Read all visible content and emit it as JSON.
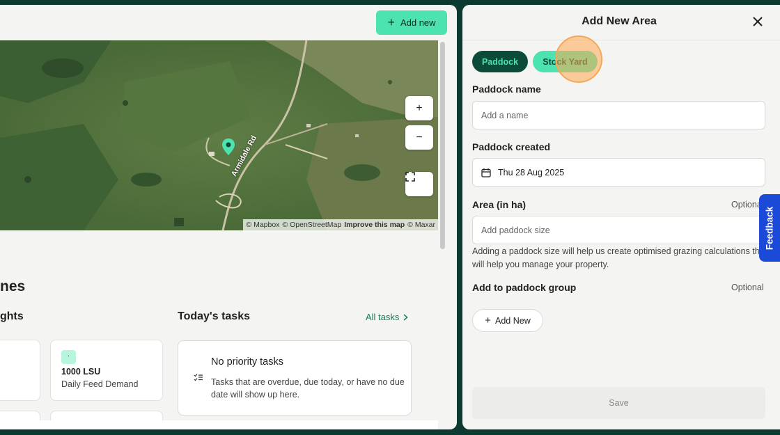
{
  "toolbar": {
    "add_new_label": "Add new"
  },
  "map": {
    "road_label": "Armidale Rd",
    "zoom_in": "+",
    "zoom_out": "−",
    "attribution": {
      "mapbox": "© Mapbox",
      "osm": "© OpenStreetMap",
      "improve": "Improve this map",
      "maxar": "© Maxar"
    }
  },
  "dashboard": {
    "heading_partial": "nes",
    "insights_partial": "ghts",
    "card": {
      "chip": "·",
      "value": "1000  LSU",
      "label": "Daily Feed Demand"
    },
    "tasks": {
      "title": "Today's tasks",
      "all_link": "All tasks",
      "empty_title": "No priority tasks",
      "empty_text": "Tasks that are overdue, due today, or have no due date will show up here."
    }
  },
  "drawer": {
    "title": "Add New Area",
    "tabs": [
      {
        "label": "Paddock",
        "active": true
      },
      {
        "label": "Stock Yard",
        "active": false
      }
    ],
    "fields": {
      "name_label": "Paddock name",
      "name_placeholder": "Add a name",
      "created_label": "Paddock created",
      "created_value": "Thu 28 Aug 2025",
      "area_label": "Area (in ha)",
      "area_optional": "Optional",
      "area_placeholder": "Add paddock size",
      "area_help": "Adding a paddock size will help us create optimised grazing calculations that will help you manage your property.",
      "group_label": "Add to paddock group",
      "group_optional": "Optional",
      "add_new": "Add New"
    },
    "save_label": "Save"
  },
  "feedback": {
    "label": "Feedback"
  },
  "colors": {
    "accent": "#4de3b1",
    "dark_green": "#0c4a3a",
    "feedback_blue": "#1b49d8"
  }
}
